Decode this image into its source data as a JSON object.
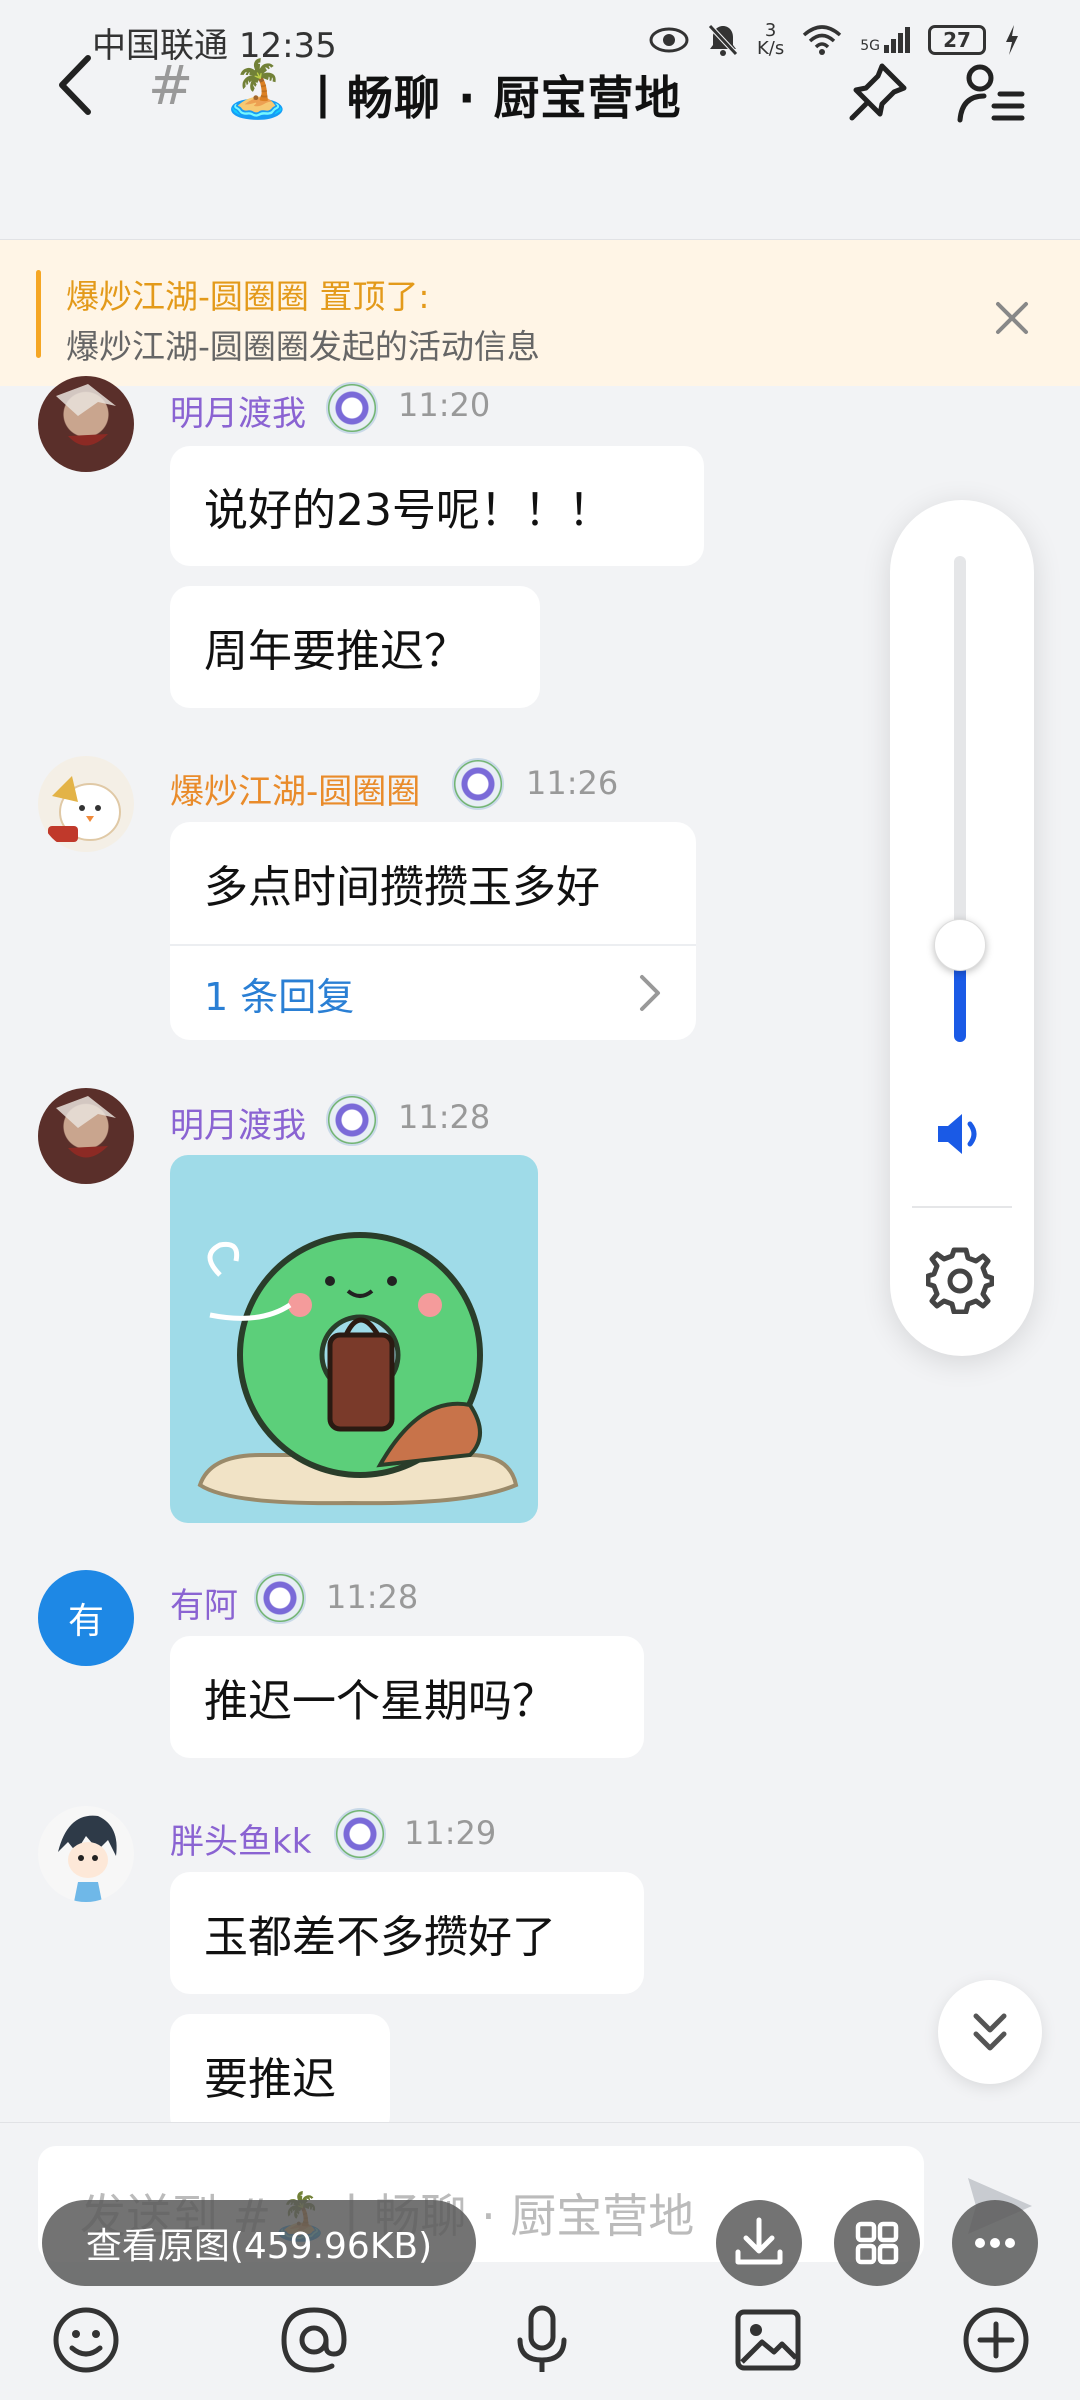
{
  "status_bar": {
    "carrier": "中国联通",
    "time": "12:35",
    "speed_value": "3",
    "speed_unit": "K/s",
    "network": "5G",
    "battery": "27"
  },
  "header": {
    "hash": "#",
    "channel_emoji": "🏝️",
    "title": "丨畅聊 · 厨宝营地"
  },
  "pinned": {
    "title": "爆炒江湖-圆圈圈 置顶了:",
    "text": "爆炒江湖-圆圈圈发起的活动信息"
  },
  "messages": [
    {
      "user": "明月渡我",
      "time": "11:20",
      "bubbles": [
        "说好的23号呢！！！",
        "周年要推迟？"
      ]
    },
    {
      "user": "爆炒江湖-圆圈圈",
      "time": "11:26",
      "text": "多点时间攒攒玉多好",
      "reply_label": "1 条回复"
    },
    {
      "user": "明月渡我",
      "time": "11:28",
      "sticker": true
    },
    {
      "user": "有阿",
      "avatar_text": "有",
      "time": "11:28",
      "bubbles": [
        "推迟一个星期吗？"
      ]
    },
    {
      "user": "胖头鱼kk",
      "time": "11:29",
      "bubbles": [
        "玉都差不多攒好了",
        "要推迟"
      ]
    }
  ],
  "input": {
    "placeholder": "发送到 #🏝️丨畅聊 · 厨宝营地"
  },
  "image_overlay": {
    "view_original": "查看原图(459.96KB)"
  },
  "volume": {
    "level": 0.2
  },
  "colors": {
    "accent_blue": "#1a5ae6",
    "username_purple": "#8a63d2",
    "username_orange": "#e98b2a",
    "pinned_bg": "#fff5e6",
    "reply_blue": "#2a7fd4"
  }
}
